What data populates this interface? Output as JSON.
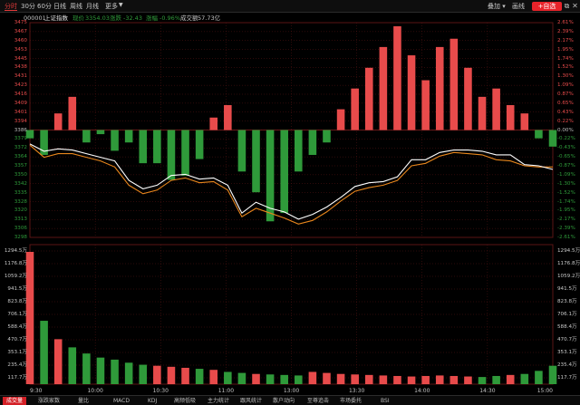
{
  "period_tabs": [
    "分时",
    "30分",
    "60分",
    "日线",
    "周线",
    "月线",
    "更多"
  ],
  "toolbar": {
    "overlay_label": "叠加",
    "drawline_label": "画线",
    "watchlist_label": "+自选"
  },
  "info": {
    "code": "000001",
    "name": "上证指数",
    "price_label": "现价",
    "price": "3354.03",
    "change_label": "涨跌",
    "change": "-32.43",
    "pct_label": "涨幅",
    "pct": "-0.96%",
    "amount_label": "成交额",
    "amount": "57.73亿"
  },
  "price_axis_left": [
    "3475",
    "3467",
    "3460",
    "3453",
    "3445",
    "3438",
    "3431",
    "3423",
    "3416",
    "3409",
    "3401",
    "3394",
    "3386",
    "3379",
    "3372",
    "3364",
    "3357",
    "3350",
    "3342",
    "3335",
    "3328",
    "3320",
    "3313",
    "3306",
    "3298"
  ],
  "price_axis_right": [
    "2.61%",
    "2.39%",
    "2.17%",
    "1.95%",
    "1.74%",
    "1.52%",
    "1.30%",
    "1.09%",
    "0.87%",
    "0.65%",
    "0.43%",
    "0.22%",
    "0.00%",
    "-0.22%",
    "-0.43%",
    "-0.65%",
    "-0.87%",
    "-1.09%",
    "-1.30%",
    "-1.52%",
    "-1.74%",
    "-1.95%",
    "-2.17%",
    "-2.39%",
    "-2.61%"
  ],
  "volume_axis": [
    "1294.5万",
    "1176.8万",
    "1059.2万",
    "941.5万",
    "823.8万",
    "706.1万",
    "588.4万",
    "470.7万",
    "353.1万",
    "235.4万",
    "117.7万"
  ],
  "time_axis": [
    "9:30",
    "10:00",
    "10:30",
    "11:00",
    "13:00",
    "13:30",
    "14:00",
    "14:30",
    "15:00"
  ],
  "bottom_tabs": [
    "成交量",
    "涨跌家数",
    "量比",
    "MACD",
    "KDJ",
    "高频低吸",
    "主力统计",
    "跟风统计",
    "散户动向",
    "至尊追击",
    "市场委托",
    "BSI"
  ],
  "colors": {
    "up": "#e84b4b",
    "down": "#2f9a3a",
    "price_line": "#ffffff",
    "avg_line": "#e8861c",
    "grid": "#5a1515",
    "accent": "#e8232a"
  },
  "chart_data": {
    "type": "line",
    "title": "",
    "prev_close": 3386,
    "x": [
      "9:30",
      "10:00",
      "10:30",
      "11:00",
      "13:00",
      "13:30",
      "14:00",
      "14:30",
      "15:00"
    ],
    "ylim": [
      3298,
      3475
    ],
    "series": [
      {
        "values": [
          3375,
          3369,
          3371,
          3370,
          3367,
          3364,
          3361,
          3345,
          3338,
          3341,
          3349,
          3350,
          3346,
          3347,
          3341,
          3318,
          3327,
          3322,
          3319,
          3313,
          3317,
          3323,
          3331,
          3340,
          3343,
          3344,
          3348,
          3362,
          3362,
          3368,
          3370,
          3370,
          3369,
          3366,
          3366,
          3358,
          3357,
          3354
        ]
      },
      {
        "values": [
          3374,
          3364,
          3367,
          3367,
          3364,
          3361,
          3356,
          3341,
          3334,
          3337,
          3345,
          3347,
          3343,
          3344,
          3337,
          3315,
          3322,
          3318,
          3314,
          3309,
          3312,
          3319,
          3328,
          3336,
          3339,
          3341,
          3345,
          3357,
          3359,
          3365,
          3368,
          3367,
          3366,
          3362,
          3361,
          3357,
          3356,
          3356
        ]
      }
    ],
    "breadth": [
      -2,
      -6,
      4,
      8,
      -3,
      -1,
      -5,
      -3,
      -8,
      -8,
      -12,
      -11,
      -7,
      3,
      6,
      -10,
      -15,
      -22,
      -20,
      -10,
      -6,
      -3,
      5,
      10,
      15,
      20,
      25,
      18,
      12,
      20,
      22,
      15,
      8,
      10,
      6,
      4,
      -2,
      -4
    ],
    "volume": [
      1294,
      620,
      440,
      360,
      300,
      260,
      240,
      210,
      190,
      180,
      170,
      160,
      150,
      140,
      120,
      110,
      100,
      95,
      90,
      85,
      120,
      110,
      100,
      95,
      90,
      85,
      80,
      75,
      80,
      85,
      80,
      75,
      70,
      80,
      90,
      100,
      130,
      180
    ]
  }
}
